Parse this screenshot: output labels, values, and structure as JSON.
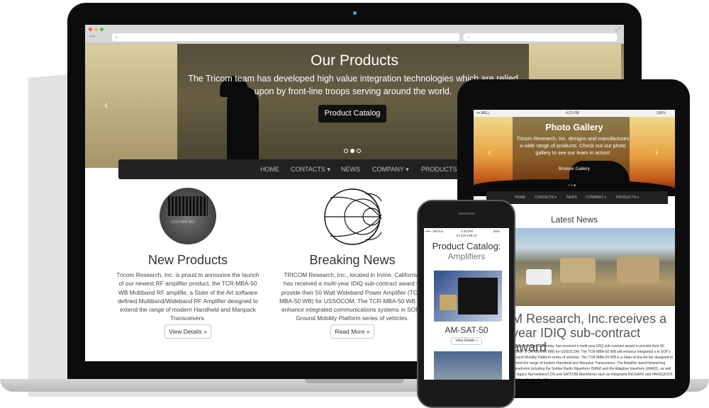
{
  "laptop": {
    "browser": {
      "url_placeholder": "+",
      "search_icon": "search-icon"
    },
    "hero": {
      "title": "Our Products",
      "text": "The Tricom team has developed high value integration technologies which are relied upon by front-line troops serving around the world.",
      "button": "Product Catalog",
      "slide_count": 3,
      "active_slide": 2
    },
    "nav": [
      "HOME",
      "CONTACTS ▾",
      "NEWS",
      "COMPANY ▾",
      "PRODUCTS ▾"
    ],
    "columns": [
      {
        "title": "New Products",
        "text": "Tricom Research, Inc. is proud to announce the launch of our newest RF amplifier product, the TCR-MBA-50 WB Multiband RF amplifie, a State of the Art software defined Multiband/Wideband RF Amplifier designed to extend the range of modern Handheld and Manpack Transceivers.",
        "button": "View Details »",
        "image_text": "LOS  PWR  SAT"
      },
      {
        "title": "Breaking News",
        "text": "TRICOM Research, Inc., located in Irvine, California, has received a multi-year IDIQ sub-contract award to provide their 50 Watt Wideband Power Amplifier (TCR-MBA-50 WB) for USSOCOM. The TCR-MBA-50 WB will enhance integrated communications systems in SOF's Ground Mobility Platform series of vehicles.",
        "button": "Read More »"
      }
    ]
  },
  "tablet": {
    "status": {
      "carrier": "••• BELL",
      "time": "4:21 PM",
      "battery": "100%"
    },
    "hero": {
      "title": "Photo Gallery",
      "text": "Tricom Research, Inc. designs and manufactures a wide range of products. Check out our photo gallery to see our team in action!",
      "button": "Browse Gallery",
      "slide_count": 3,
      "active_slide": 3
    },
    "nav": [
      "HOME",
      "CONTACTS ▾",
      "NEWS",
      "COMPANY ▾",
      "PRODUCTS ▾"
    ],
    "section_title": "Latest News",
    "headline": "M Research, Inc.receives a year IDIQ sub-contract award",
    "text": "located in Irvine, California, has received a multi-year IDIQ sub-contract award to provide their 50 mplifier (TCR-MBA-50 WB) for USSOCOM. The TCR-MBA-50 WB will enhance integrated s in SOF's Ground Mobility Platform series of vehicles. The TCR-MBA-50 WB is a State-of-the-Art fier designed to extend the range of modern Handheld and Manpack Transceivers. The Amplifier band Networking Waveforms including the Soldier Radio Waveform (SRW) and the Adaptive Vaveform (ANW2), as well as legacy Narrowband LOS and SATCOM Waveforms such as Integrated INCGARS and HAVEQUICK. Additionally, the Amplifier integrates seamlessly into systems using"
  },
  "phone": {
    "status": {
      "carrier": "••••○ Verizon",
      "time": "4:46 PM",
      "battery": "56%",
      "address": "67.219.128.10"
    },
    "title": "Product Catalog:",
    "subtitle": "Amplifiers",
    "product": "AM-SAT-50",
    "button": "View Details »"
  }
}
